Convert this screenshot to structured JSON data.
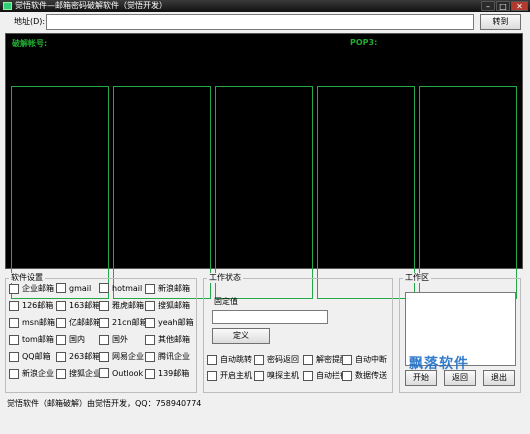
{
  "window": {
    "title": "觉悟软件—邮箱密码破解软件（觉悟开发）",
    "min": "–",
    "max": "□",
    "close": "✕"
  },
  "address": {
    "label": "地址(D):",
    "value": "",
    "go_button": "转到"
  },
  "display": {
    "account_label": "破解帐号:",
    "pop3_label": "POP3:"
  },
  "software_settings": {
    "legend": "软件设置",
    "options": [
      [
        "企业邮箱",
        "gmail",
        "hotmail",
        "新浪邮箱"
      ],
      [
        "126邮箱",
        "163邮箱",
        "雅虎邮箱",
        "搜狐邮箱"
      ],
      [
        "msn邮箱",
        "亿邮邮箱",
        "21cn邮箱",
        "yeah邮箱"
      ],
      [
        "tom邮箱",
        "国内",
        "国外",
        "其他邮箱"
      ],
      [
        "QQ邮箱",
        "263邮箱",
        "网易企业",
        "腾讯企业"
      ],
      [
        "新浪企业",
        "搜狐企业",
        "Outlook",
        "139邮箱"
      ]
    ]
  },
  "work_status": {
    "legend": "工作状态",
    "fixed_label": "固定值",
    "fixed_value": "",
    "define_button": "定义",
    "options": [
      [
        "自动跳转",
        "密码返回",
        "解密提醒",
        "自动中断"
      ],
      [
        "开启主机",
        "嗅探主机",
        "自动拦截",
        "数据传送"
      ]
    ]
  },
  "work_area": {
    "legend": "工作区",
    "start_button": "开始",
    "back_button": "返回",
    "exit_button": "退出"
  },
  "watermark": "飘落软件",
  "status_bar": "觉悟软件（邮箱破解）由觉悟开发，QQ：758940774"
}
